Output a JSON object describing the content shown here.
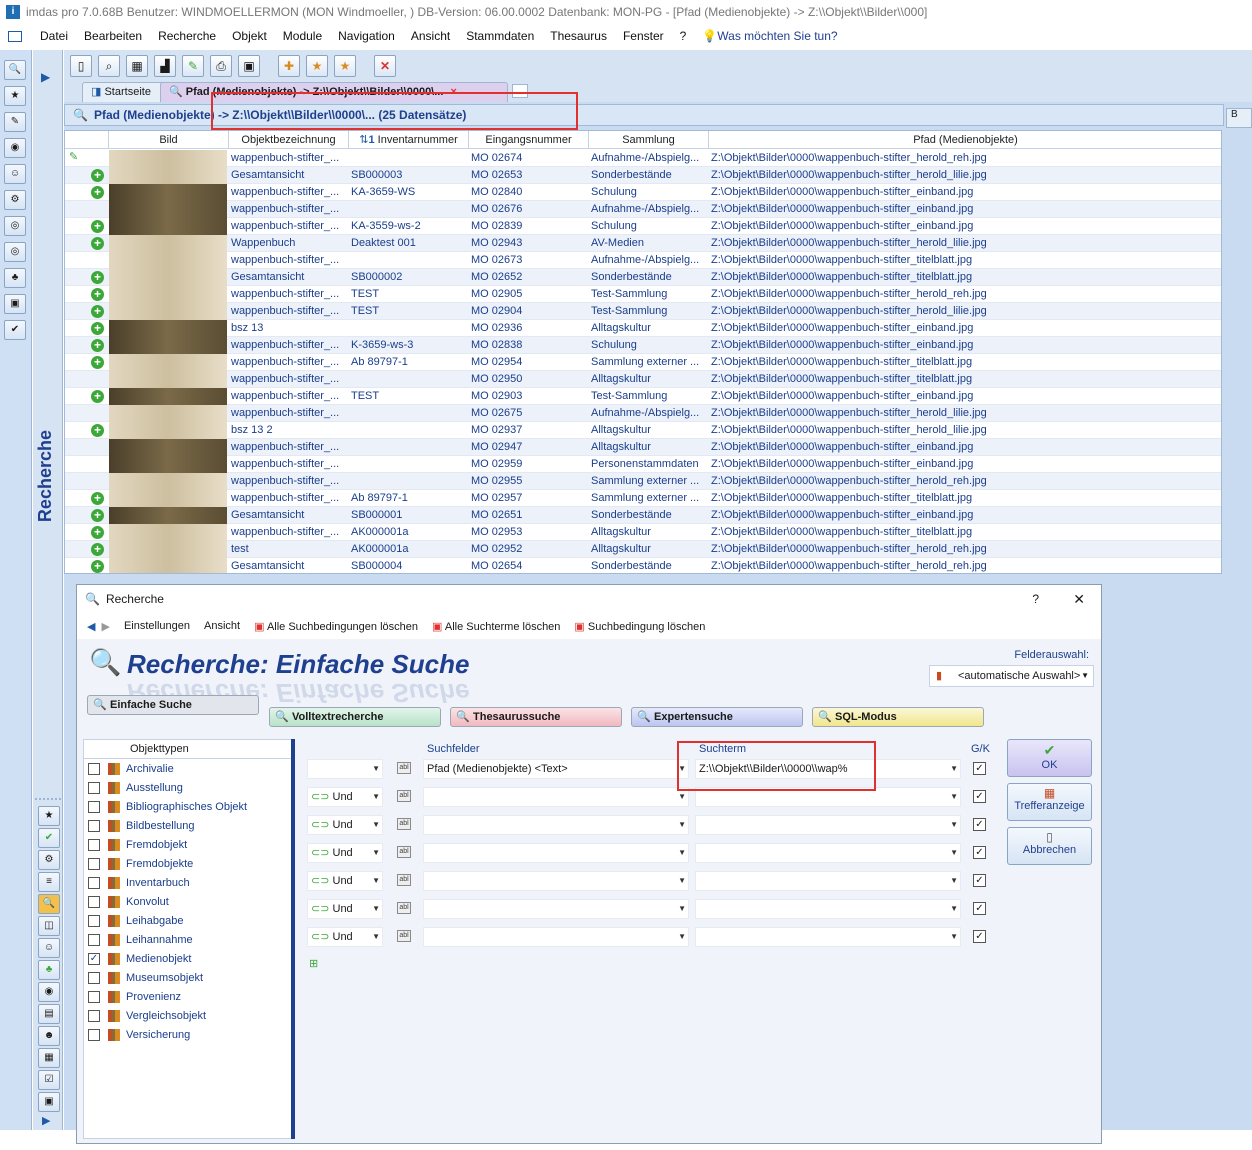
{
  "window": {
    "title": "imdas pro 7.0.68B Benutzer: WINDMOELLERMON (MON Windmoeller, )  DB-Version: 06.00.0002  Datenbank: MON-PG - [Pfad (Medienobjekte) -> Z:\\\\Objekt\\\\Bilder\\\\000]"
  },
  "menu": {
    "items": [
      "Datei",
      "Bearbeiten",
      "Recherche",
      "Objekt",
      "Module",
      "Navigation",
      "Ansicht",
      "Stammdaten",
      "Thesaurus",
      "Fenster",
      "?"
    ],
    "help_prompt": "Was möchten Sie tun?"
  },
  "sidebar": {
    "label": "Recherche"
  },
  "tabs": {
    "home": "Startseite",
    "active": "Pfad (Medienobjekte) -> Z:\\\\Objekt\\\\Bilder\\\\0000\\..."
  },
  "grid": {
    "header_text": "Pfad (Medienobjekte) -> Z:\\\\Objekt\\\\Bilder\\\\0000\\... (25 Datensätze)",
    "columns": [
      "Bild",
      "Objektbezeichnung",
      "Inventarnummer",
      "Eingangsnummer",
      "Sammlung",
      "Pfad (Medienobjekte)"
    ],
    "sort_marker": "1",
    "rows": [
      {
        "plus": false,
        "dark": false,
        "bez": "wappenbuch-stifter_...",
        "inv": "",
        "ein": "MO 02674",
        "sam": "Aufnahme-/Abspielg...",
        "pfad": "Z:\\Objekt\\Bilder\\0000\\wappenbuch-stifter_herold_reh.jpg"
      },
      {
        "plus": true,
        "dark": false,
        "bez": "Gesamtansicht",
        "inv": "SB000003",
        "ein": "MO 02653",
        "sam": "Sonderbestände",
        "pfad": "Z:\\Objekt\\Bilder\\0000\\wappenbuch-stifter_herold_lilie.jpg"
      },
      {
        "plus": true,
        "dark": true,
        "bez": "wappenbuch-stifter_...",
        "inv": "KA-3659-WS",
        "ein": "MO 02840",
        "sam": "Schulung",
        "pfad": "Z:\\Objekt\\Bilder\\0000\\wappenbuch-stifter_einband.jpg"
      },
      {
        "plus": false,
        "dark": true,
        "bez": "wappenbuch-stifter_...",
        "inv": "",
        "ein": "MO 02676",
        "sam": "Aufnahme-/Abspielg...",
        "pfad": "Z:\\Objekt\\Bilder\\0000\\wappenbuch-stifter_einband.jpg"
      },
      {
        "plus": true,
        "dark": true,
        "bez": "wappenbuch-stifter_...",
        "inv": "KA-3559-ws-2",
        "ein": "MO 02839",
        "sam": "Schulung",
        "pfad": "Z:\\Objekt\\Bilder\\0000\\wappenbuch-stifter_einband.jpg"
      },
      {
        "plus": true,
        "dark": false,
        "bez": "Wappenbuch",
        "inv": "Deaktest 001",
        "ein": "MO 02943",
        "sam": "AV-Medien",
        "pfad": "Z:\\Objekt\\Bilder\\0000\\wappenbuch-stifter_herold_lilie.jpg"
      },
      {
        "plus": false,
        "dark": false,
        "bez": "wappenbuch-stifter_...",
        "inv": "",
        "ein": "MO 02673",
        "sam": "Aufnahme-/Abspielg...",
        "pfad": "Z:\\Objekt\\Bilder\\0000\\wappenbuch-stifter_titelblatt.jpg"
      },
      {
        "plus": true,
        "dark": false,
        "bez": "Gesamtansicht",
        "inv": "SB000002",
        "ein": "MO 02652",
        "sam": "Sonderbestände",
        "pfad": "Z:\\Objekt\\Bilder\\0000\\wappenbuch-stifter_titelblatt.jpg"
      },
      {
        "plus": true,
        "dark": false,
        "bez": "wappenbuch-stifter_...",
        "inv": "TEST",
        "ein": "MO 02905",
        "sam": "Test-Sammlung",
        "pfad": "Z:\\Objekt\\Bilder\\0000\\wappenbuch-stifter_herold_reh.jpg"
      },
      {
        "plus": true,
        "dark": false,
        "bez": "wappenbuch-stifter_...",
        "inv": "TEST",
        "ein": "MO 02904",
        "sam": "Test-Sammlung",
        "pfad": "Z:\\Objekt\\Bilder\\0000\\wappenbuch-stifter_herold_lilie.jpg"
      },
      {
        "plus": true,
        "dark": true,
        "bez": "bsz 13",
        "inv": "",
        "ein": "MO 02936",
        "sam": "Alltagskultur",
        "pfad": "Z:\\Objekt\\Bilder\\0000\\wappenbuch-stifter_einband.jpg"
      },
      {
        "plus": true,
        "dark": true,
        "bez": "wappenbuch-stifter_...",
        "inv": "K-3659-ws-3",
        "ein": "MO 02838",
        "sam": "Schulung",
        "pfad": "Z:\\Objekt\\Bilder\\0000\\wappenbuch-stifter_einband.jpg"
      },
      {
        "plus": true,
        "dark": false,
        "bez": "wappenbuch-stifter_...",
        "inv": "Ab 89797-1",
        "ein": "MO 02954",
        "sam": "Sammlung externer ...",
        "pfad": "Z:\\Objekt\\Bilder\\0000\\wappenbuch-stifter_titelblatt.jpg"
      },
      {
        "plus": false,
        "dark": false,
        "bez": "wappenbuch-stifter_...",
        "inv": "",
        "ein": "MO 02950",
        "sam": "Alltagskultur",
        "pfad": "Z:\\Objekt\\Bilder\\0000\\wappenbuch-stifter_titelblatt.jpg"
      },
      {
        "plus": true,
        "dark": true,
        "bez": "wappenbuch-stifter_...",
        "inv": "TEST",
        "ein": "MO 02903",
        "sam": "Test-Sammlung",
        "pfad": "Z:\\Objekt\\Bilder\\0000\\wappenbuch-stifter_einband.jpg"
      },
      {
        "plus": false,
        "dark": false,
        "bez": "wappenbuch-stifter_...",
        "inv": "",
        "ein": "MO 02675",
        "sam": "Aufnahme-/Abspielg...",
        "pfad": "Z:\\Objekt\\Bilder\\0000\\wappenbuch-stifter_herold_lilie.jpg"
      },
      {
        "plus": true,
        "dark": false,
        "bez": "bsz 13 2",
        "inv": "",
        "ein": "MO 02937",
        "sam": "Alltagskultur",
        "pfad": "Z:\\Objekt\\Bilder\\0000\\wappenbuch-stifter_herold_lilie.jpg"
      },
      {
        "plus": false,
        "dark": true,
        "bez": "wappenbuch-stifter_...",
        "inv": "",
        "ein": "MO 02947",
        "sam": "Alltagskultur",
        "pfad": "Z:\\Objekt\\Bilder\\0000\\wappenbuch-stifter_einband.jpg"
      },
      {
        "plus": false,
        "dark": true,
        "bez": "wappenbuch-stifter_...",
        "inv": "",
        "ein": "MO 02959",
        "sam": "Personenstammdaten",
        "pfad": "Z:\\Objekt\\Bilder\\0000\\wappenbuch-stifter_einband.jpg"
      },
      {
        "plus": false,
        "dark": false,
        "bez": "wappenbuch-stifter_...",
        "inv": "",
        "ein": "MO 02955",
        "sam": "Sammlung externer ...",
        "pfad": "Z:\\Objekt\\Bilder\\0000\\wappenbuch-stifter_herold_reh.jpg"
      },
      {
        "plus": true,
        "dark": false,
        "bez": "wappenbuch-stifter_...",
        "inv": "Ab 89797-1",
        "ein": "MO 02957",
        "sam": "Sammlung externer ...",
        "pfad": "Z:\\Objekt\\Bilder\\0000\\wappenbuch-stifter_titelblatt.jpg"
      },
      {
        "plus": true,
        "dark": true,
        "bez": "Gesamtansicht",
        "inv": "SB000001",
        "ein": "MO 02651",
        "sam": "Sonderbestände",
        "pfad": "Z:\\Objekt\\Bilder\\0000\\wappenbuch-stifter_einband.jpg"
      },
      {
        "plus": true,
        "dark": false,
        "bez": "wappenbuch-stifter_...",
        "inv": "AK000001a",
        "ein": "MO 02953",
        "sam": "Alltagskultur",
        "pfad": "Z:\\Objekt\\Bilder\\0000\\wappenbuch-stifter_titelblatt.jpg"
      },
      {
        "plus": true,
        "dark": false,
        "bez": "test",
        "inv": "AK000001a",
        "ein": "MO 02952",
        "sam": "Alltagskultur",
        "pfad": "Z:\\Objekt\\Bilder\\0000\\wappenbuch-stifter_herold_reh.jpg"
      },
      {
        "plus": true,
        "dark": false,
        "bez": "Gesamtansicht",
        "inv": "SB000004",
        "ein": "MO 02654",
        "sam": "Sonderbestände",
        "pfad": "Z:\\Objekt\\Bilder\\0000\\wappenbuch-stifter_herold_reh.jpg"
      }
    ]
  },
  "dialog": {
    "title": "Recherche",
    "help": "?",
    "close": "✕",
    "toolbar": {
      "settings": "Einstellungen",
      "view": "Ansicht",
      "clear_conditions": "Alle Suchbedingungen löschen",
      "clear_terms": "Alle Suchterme löschen",
      "delete_condition": "Suchbedingung löschen"
    },
    "heading": "Recherche: Einfache Suche",
    "field_selection_label": "Felderauswahl:",
    "field_selection_value": "<automatische Auswahl>",
    "modes": {
      "simple": "Einfache Suche",
      "fulltext": "Volltextrecherche",
      "thesaurus": "Thesaurussuche",
      "expert": "Expertensuche",
      "sql": "SQL-Modus"
    },
    "object_types_header": "Objekttypen",
    "object_types": [
      {
        "label": "Archivalie",
        "checked": false
      },
      {
        "label": "Ausstellung",
        "checked": false
      },
      {
        "label": "Bibliographisches Objekt",
        "checked": false
      },
      {
        "label": "Bildbestellung",
        "checked": false
      },
      {
        "label": "Fremdobjekt",
        "checked": false
      },
      {
        "label": "Fremdobjekte",
        "checked": false
      },
      {
        "label": "Inventarbuch",
        "checked": false
      },
      {
        "label": "Konvolut",
        "checked": false
      },
      {
        "label": "Leihabgabe",
        "checked": false
      },
      {
        "label": "Leihannahme",
        "checked": false
      },
      {
        "label": "Medienobjekt",
        "checked": true
      },
      {
        "label": "Museumsobjekt",
        "checked": false
      },
      {
        "label": "Provenienz",
        "checked": false
      },
      {
        "label": "Vergleichsobjekt",
        "checked": false
      },
      {
        "label": "Versicherung",
        "checked": false
      }
    ],
    "search_fields_header": "Suchfelder",
    "search_term_header": "Suchterm",
    "gk_header": "G/K",
    "first_field": "Pfad (Medienobjekte) <Text>",
    "first_term": "Z:\\\\Objekt\\\\Bilder\\\\0000\\\\wap%",
    "operator": "Und",
    "ok": "OK",
    "hits": "Trefferanzeige",
    "cancel": "Abbrechen"
  }
}
